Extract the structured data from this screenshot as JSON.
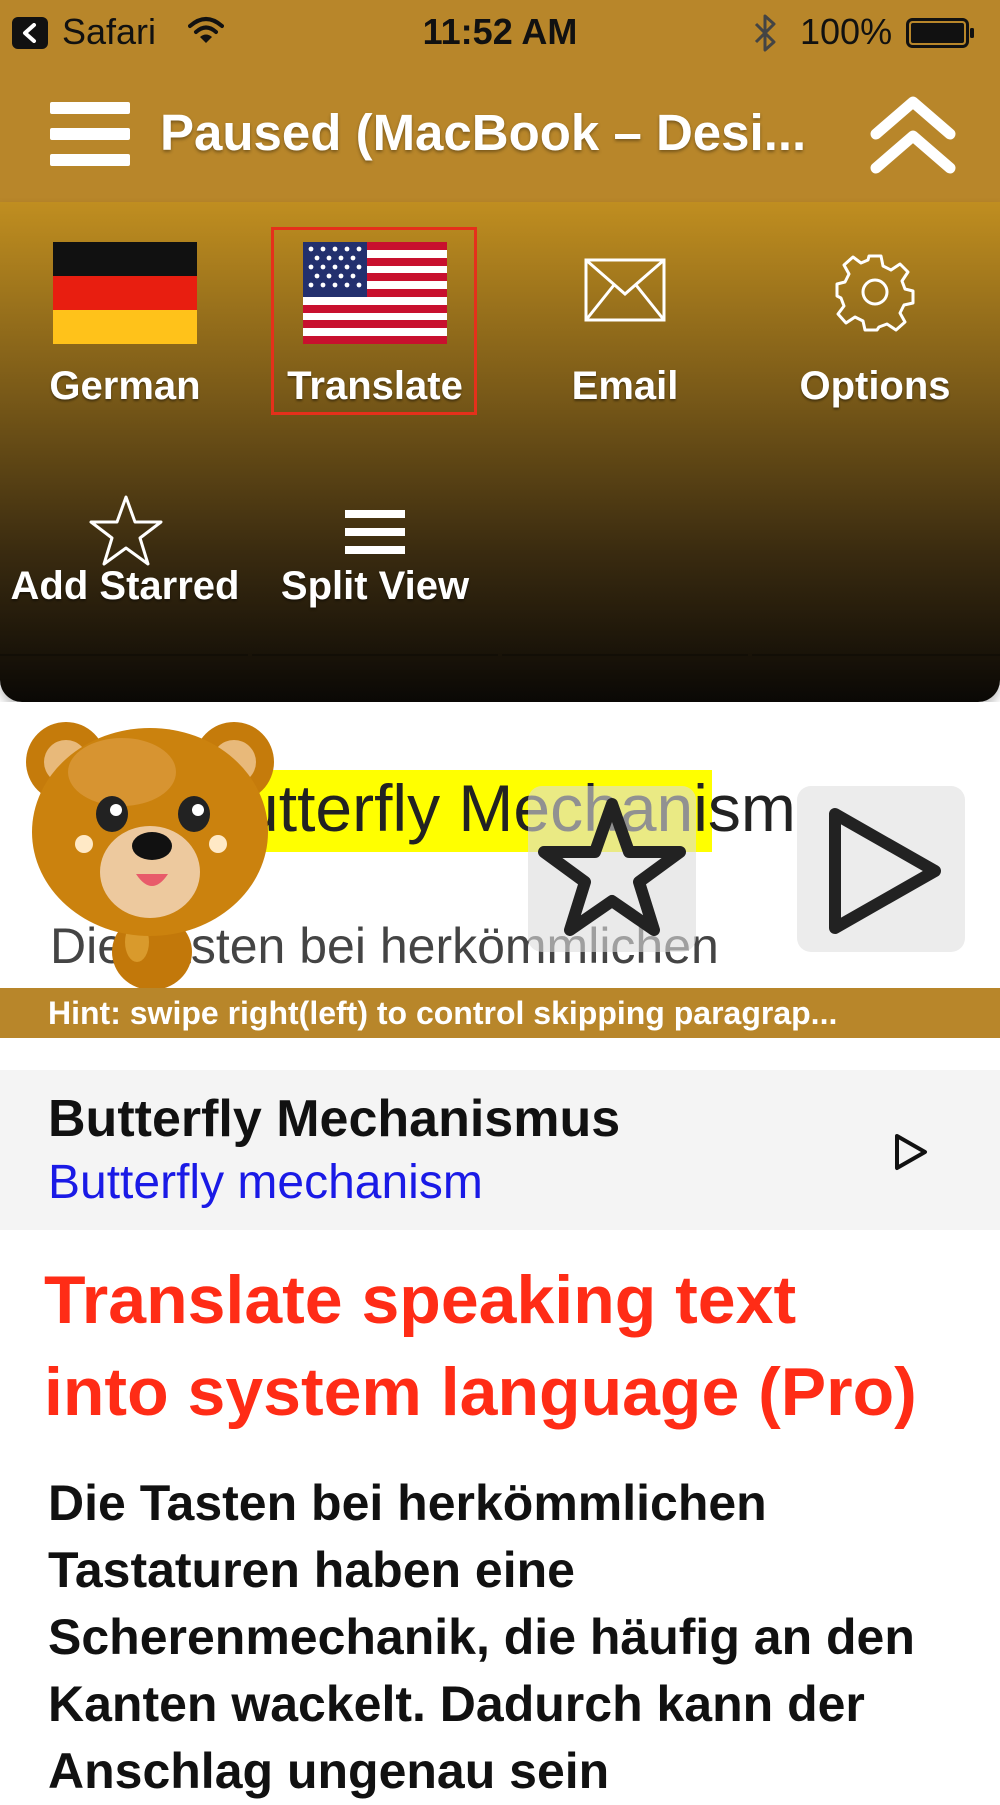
{
  "status_bar": {
    "back_app": "Safari",
    "time": "11:52 AM",
    "battery": "100%"
  },
  "nav": {
    "title": "Paused (MacBook – Desi..."
  },
  "menu": {
    "items": [
      {
        "label": "German",
        "icon": "german-flag-icon"
      },
      {
        "label": "Translate",
        "icon": "us-flag-icon",
        "selected": true
      },
      {
        "label": "Email",
        "icon": "envelope-icon"
      },
      {
        "label": "Options",
        "icon": "gear-icon"
      },
      {
        "label": "Add Starred",
        "icon": "star-icon"
      },
      {
        "label": "Split View",
        "icon": "lines-icon"
      }
    ]
  },
  "player": {
    "title": "Butterfly Mechanismus",
    "subtitle": "Die Tasten bei herkömmlichen",
    "hint": "Hint: swipe right(left) to control skipping paragrap..."
  },
  "sentence": {
    "original": "Butterfly Mechanismus",
    "translation": "Butterfly mechanism"
  },
  "promo": {
    "line1": "Translate speaking text",
    "line2": "into system language (Pro)"
  },
  "body_text": "Die Tasten bei herkömmlichen Tastaturen haben eine Scherenmechanik, die häufig an den Kanten wackelt. Dadurch kann der Anschlag ungenau sein",
  "colors": {
    "gold": "#B8862A",
    "highlight": "#FFFF00",
    "promo_red": "#FF2C16",
    "translation_blue": "#1A1AE6",
    "selected_outline": "#E5301B"
  }
}
